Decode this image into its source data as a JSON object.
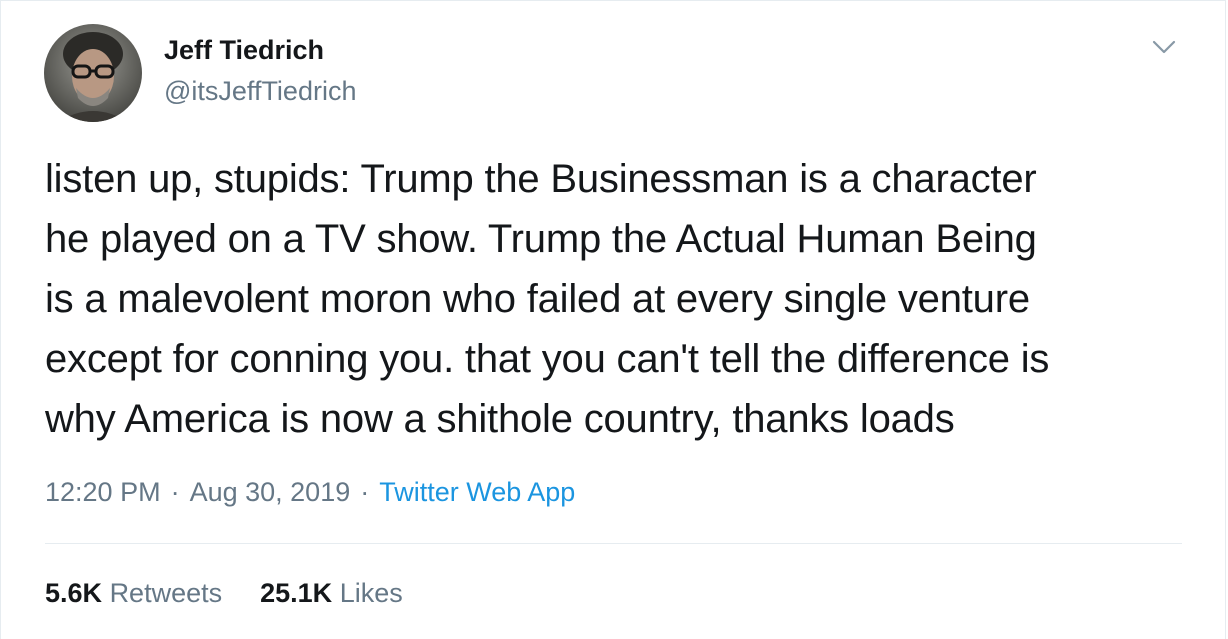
{
  "tweet": {
    "author": {
      "display_name": "Jeff Tiedrich",
      "handle": "@itsJeffTiedrich"
    },
    "text_lines": [
      "listen up, stupids: Trump the Businessman is a character",
      "he played on a TV show. Trump the Actual Human Being",
      "is a malevolent moron who failed at every single venture",
      "except for conning you. that you can't tell the difference is",
      "why America is now a shithole country, thanks loads"
    ],
    "meta": {
      "time": "12:20 PM",
      "separator": "·",
      "date": "Aug 30, 2019",
      "source": "Twitter Web App"
    },
    "stats": {
      "retweets_count": "5.6K",
      "retweets_label": "Retweets",
      "likes_count": "25.1K",
      "likes_label": "Likes"
    }
  },
  "icons": {
    "menu": "chevron-down-icon",
    "avatar": "user-avatar"
  },
  "colors": {
    "text": "#14171a",
    "secondary": "#657786",
    "link": "#1b95e0",
    "divider": "#e6ecf0"
  }
}
